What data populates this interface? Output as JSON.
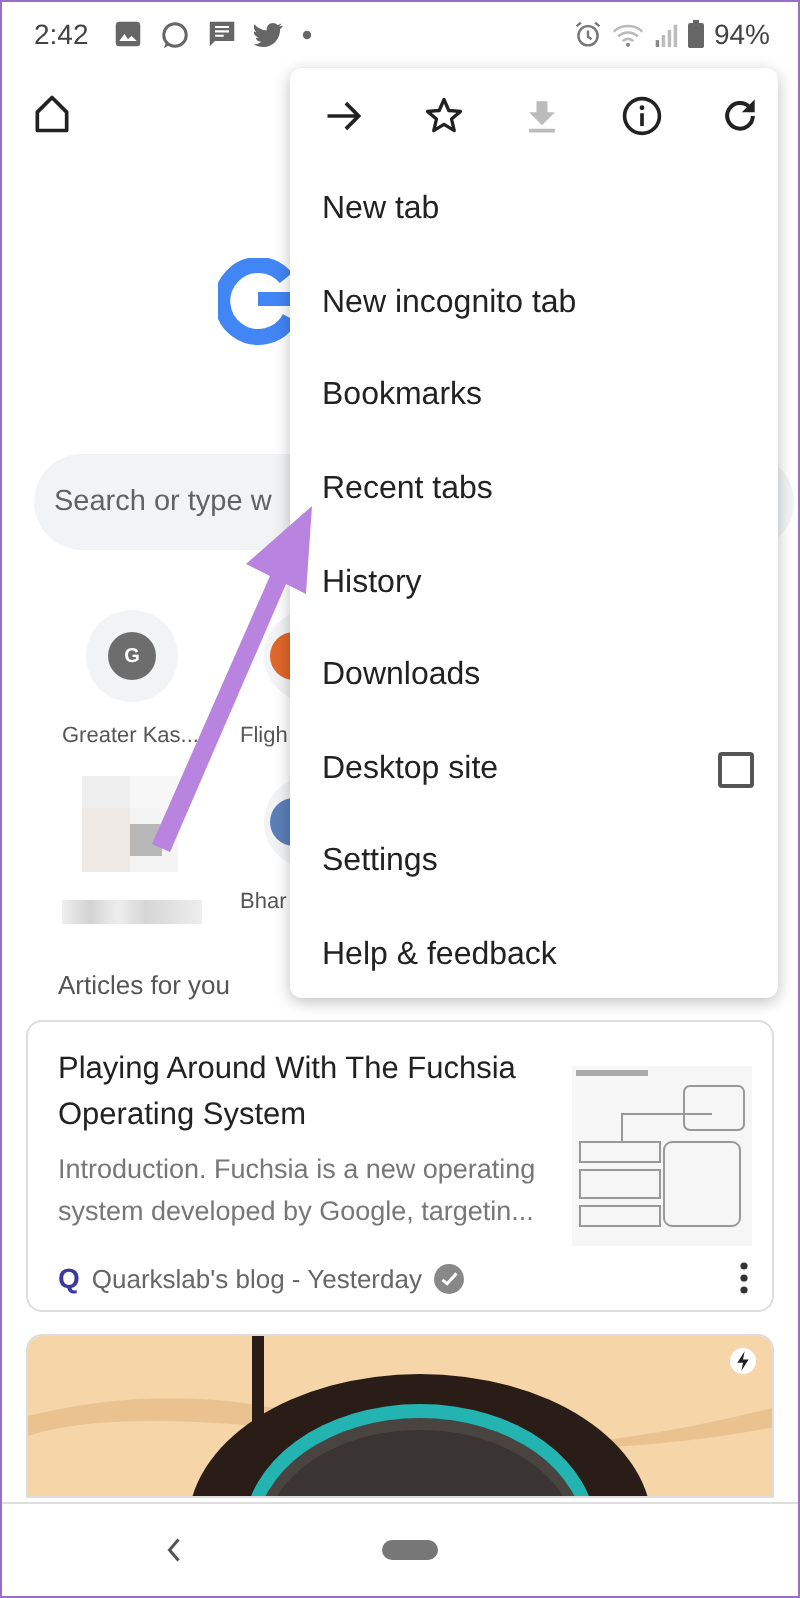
{
  "status_bar": {
    "time": "2:42",
    "battery": "94%"
  },
  "toolbar": {
    "search": {
      "placeholder": "Search or type w"
    }
  },
  "shortcuts": [
    {
      "kind": "letter",
      "letter": "G",
      "label": "Greater Kas..."
    },
    {
      "kind": "favicon",
      "color": "#e0662a",
      "label": "Fligh"
    },
    {
      "kind": "blurred"
    },
    {
      "kind": "favicon",
      "color": "#5b7fb8",
      "label": "Bhar"
    }
  ],
  "articles_heading": "Articles for you",
  "article": {
    "title": "Playing Around With The Fuchsia Operating System",
    "snippet": "Introduction. Fuchsia is a new operating system developed by Google, targetin...",
    "source": "Quarkslab's blog - Yesterday",
    "source_logo": "Q"
  },
  "menu": {
    "actions": [
      {
        "kind": "forward",
        "disabled": false
      },
      {
        "kind": "bookmark",
        "disabled": false
      },
      {
        "kind": "download",
        "disabled": true
      },
      {
        "kind": "info",
        "disabled": false
      },
      {
        "kind": "reload",
        "disabled": false
      }
    ],
    "items": [
      {
        "kind": "plain",
        "label": "New tab"
      },
      {
        "kind": "plain",
        "label": "New incognito tab"
      },
      {
        "kind": "plain",
        "label": "Bookmarks"
      },
      {
        "kind": "plain",
        "label": "Recent tabs"
      },
      {
        "kind": "plain",
        "label": "History"
      },
      {
        "kind": "plain",
        "label": "Downloads"
      },
      {
        "kind": "checkbox",
        "label": "Desktop site",
        "checked": false
      },
      {
        "kind": "plain",
        "label": "Settings"
      },
      {
        "kind": "plain",
        "label": "Help & feedback"
      }
    ]
  }
}
